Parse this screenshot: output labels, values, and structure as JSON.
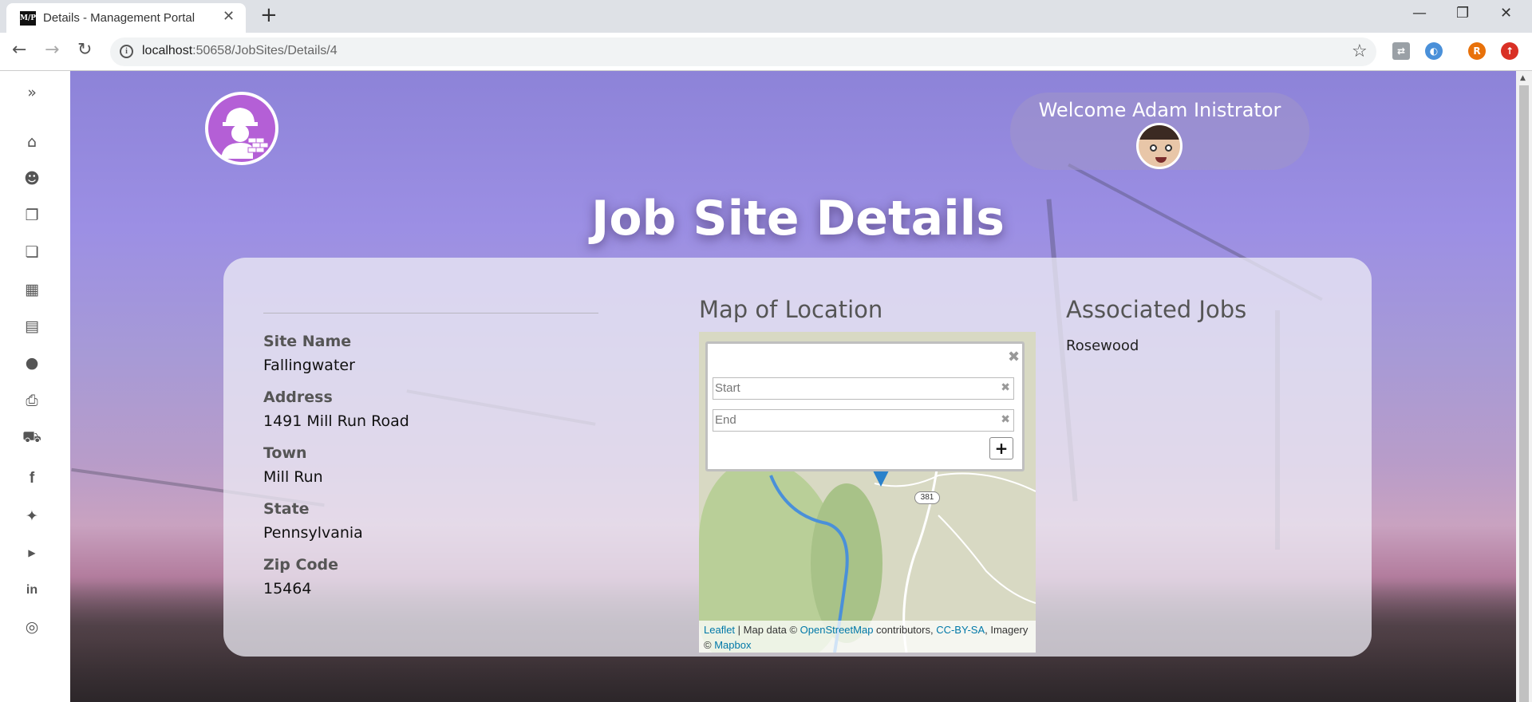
{
  "browser": {
    "tab_title": "Details - Management Portal",
    "favicon_text": "M/P",
    "url_host": "localhost",
    "url_path": ":50658/JobSites/Details/4",
    "profile_initial": "R"
  },
  "header": {
    "welcome": "Welcome Adam Inistrator"
  },
  "page_title": "Job Site Details",
  "site": {
    "labels": {
      "site_name": "Site Name",
      "address": "Address",
      "town": "Town",
      "state": "State",
      "zip": "Zip Code"
    },
    "values": {
      "site_name": "Fallingwater",
      "address": "1491 Mill Run Road",
      "town": "Mill Run",
      "state": "Pennsylvania",
      "zip": "15464"
    }
  },
  "map": {
    "title": "Map of Location",
    "start_placeholder": "Start",
    "end_placeholder": "End",
    "add_label": "+",
    "route_shield": "381",
    "attribution": {
      "leaflet": "Leaflet",
      "sep": " | Map data © ",
      "osm": "OpenStreetMap",
      "contributors": " contributors, ",
      "license": "CC-BY-SA",
      "imagery": ", Imagery © ",
      "mapbox": "Mapbox"
    }
  },
  "associated": {
    "title": "Associated Jobs",
    "jobs": [
      "Rosewood"
    ]
  },
  "sidebar": {
    "icons": [
      "expand-icon",
      "home-icon",
      "users-icon",
      "documents-icon",
      "copy-icon",
      "calendar-icon",
      "newspaper-icon",
      "chat-icon",
      "print-icon",
      "cart-icon",
      "facebook-icon",
      "twitter-icon",
      "youtube-icon",
      "linkedin-icon",
      "instagram-icon"
    ]
  },
  "colors": {
    "logo": "#b45fd6",
    "link": "#0078a8",
    "marker": "#2a81cb"
  }
}
